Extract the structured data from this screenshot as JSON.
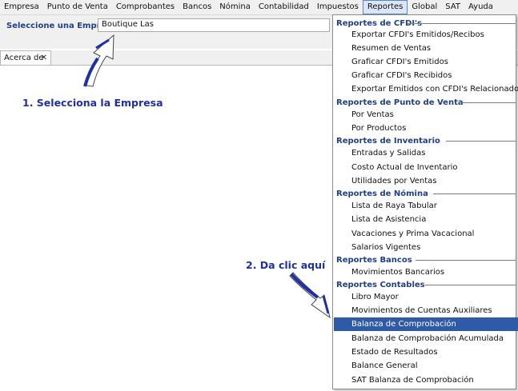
{
  "menubar": {
    "items": [
      "Empresa",
      "Punto de Venta",
      "Comprobantes",
      "Bancos",
      "Nómina",
      "Contabilidad",
      "Impuestos",
      "Reportes",
      "Global",
      "SAT",
      "Ayuda"
    ]
  },
  "company": {
    "label": "Seleccione una Empresa",
    "value": "Boutique Las"
  },
  "tab": {
    "label": "Acerca de",
    "close": "✕"
  },
  "annotations": {
    "step1": "1. Selecciona la Empresa",
    "step2": "2. Da clic aquí"
  },
  "dropdown": {
    "sections": [
      {
        "title": "Reportes de CFDI's",
        "items": [
          "Exportar CFDI's Emitidos/Recibos",
          "Resumen de Ventas",
          "Graficar CFDI's Emitidos",
          "Graficar CFDI's Recibidos",
          "Exportar Emitidos con CFDI's Relacionados"
        ]
      },
      {
        "title": "Reportes de Punto de Venta",
        "items": [
          "Por Ventas",
          "Por Productos"
        ]
      },
      {
        "title": "Reportes de Inventario",
        "items": [
          "Entradas y Salidas",
          "Costo Actual de Inventario",
          "Utilidades por Ventas"
        ]
      },
      {
        "title": "Reportes de Nómina",
        "items": [
          "Lista de Raya Tabular",
          "Lista de Asistencia",
          "Vacaciones y Prima Vacacional",
          "Salarios Vigentes"
        ]
      },
      {
        "title": "Reportes Bancos",
        "items": [
          "Movimientos Bancarios"
        ]
      },
      {
        "title": "Reportes Contables",
        "items": [
          "Libro Mayor",
          "Movimientos de Cuentas Auxiliares",
          "Balanza de Comprobación",
          "Balanza de Comprobación Acumulada",
          "Estado de Resultados",
          "Balance General",
          "SAT Balanza de Comprobación"
        ]
      }
    ],
    "selected": "Balanza de Comprobación"
  },
  "colors": {
    "accent": "#1e3f8a",
    "selection": "#2e5aa8",
    "annotation": "#1f2fa6"
  }
}
